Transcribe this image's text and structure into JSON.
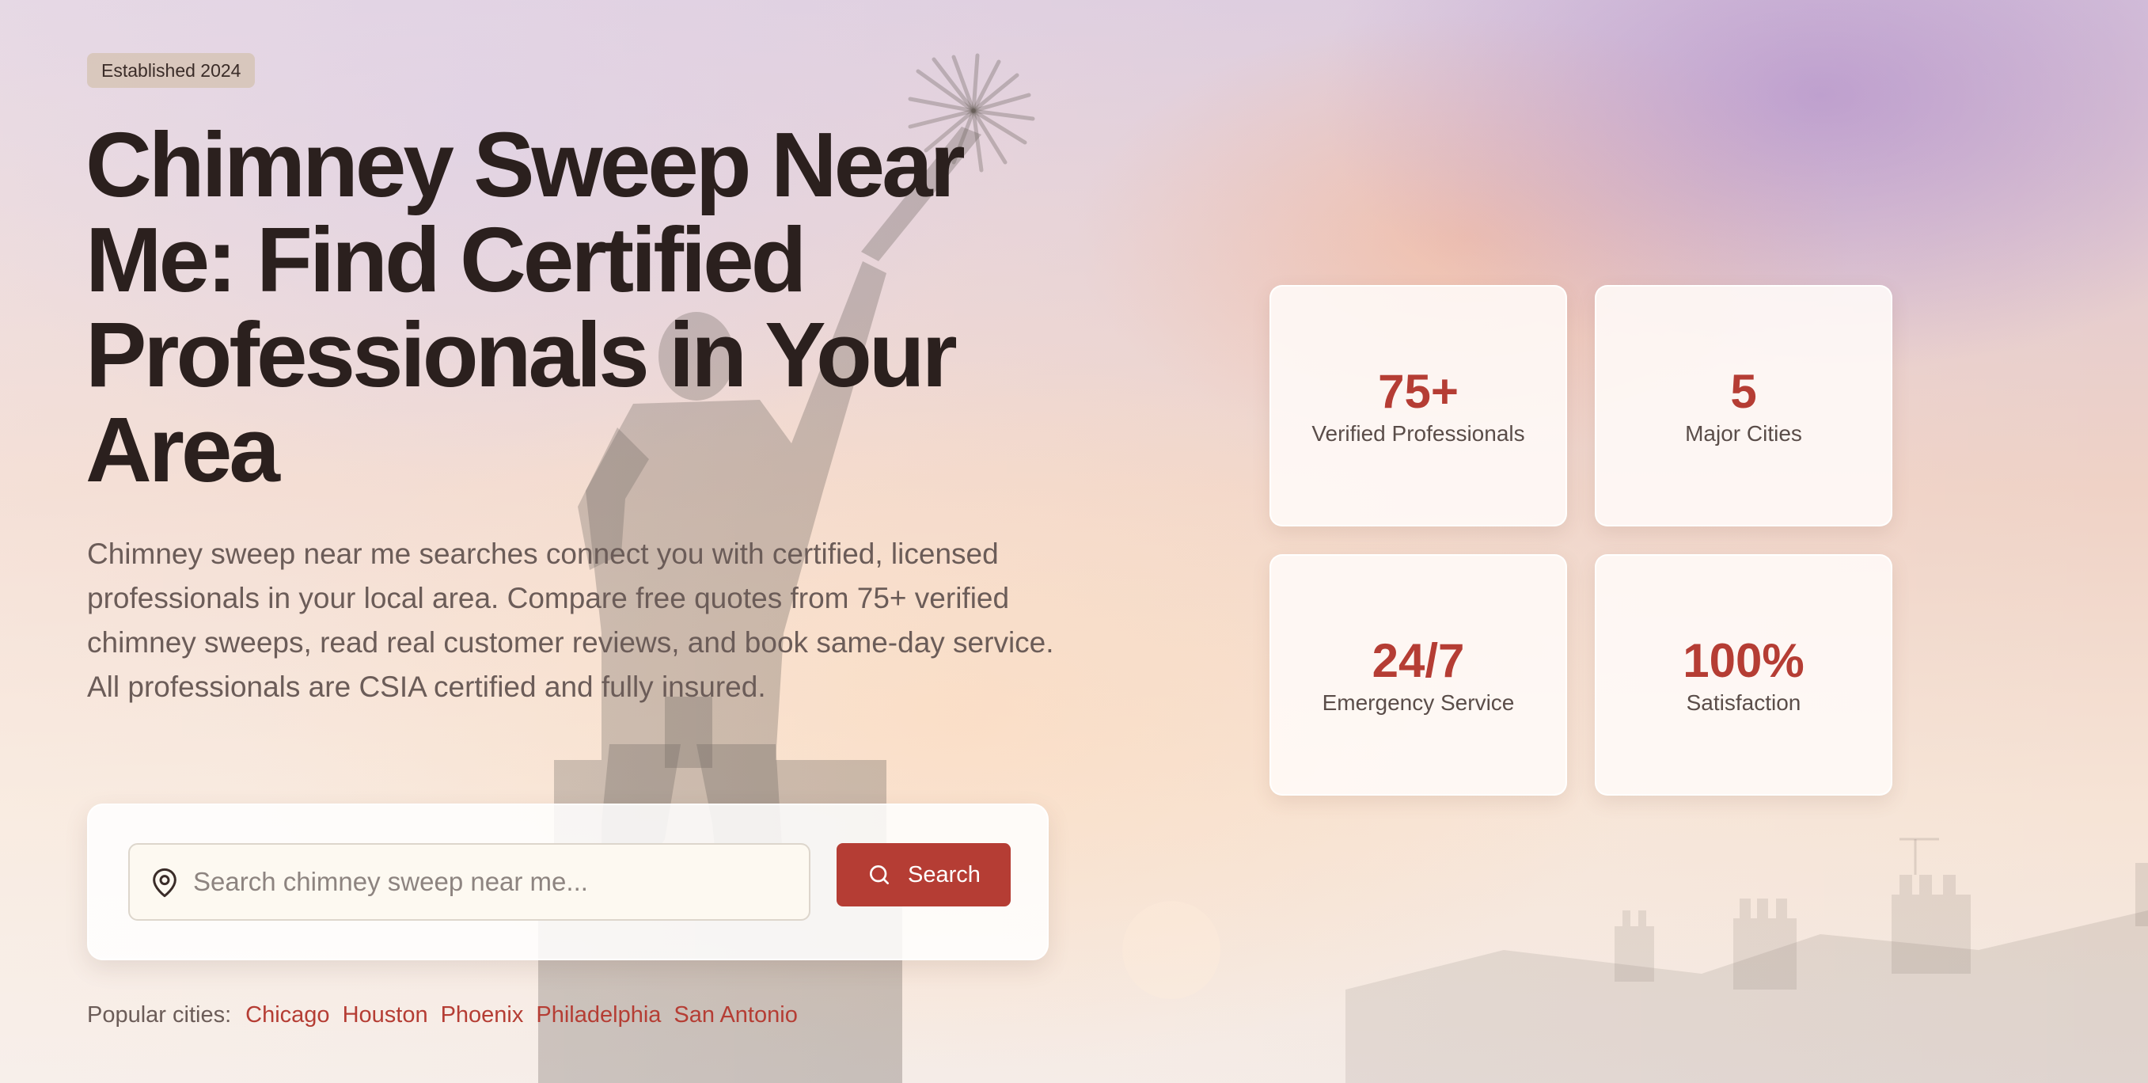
{
  "hero": {
    "badge": "Established 2024",
    "title": "Chimney Sweep Near Me: Find Certified Professionals in Your Area",
    "description": "Chimney sweep near me searches connect you with certified, licensed professionals in your local area. Compare free quotes from 75+ verified chimney sweeps, read real customer reviews, and book same-day service. All professionals are CSIA certified and fully insured."
  },
  "search": {
    "placeholder": "Search chimney sweep near me...",
    "value": "",
    "button_label": "Search",
    "field_icon": "map-pin-icon",
    "button_icon": "search-icon"
  },
  "popular": {
    "label": "Popular cities:",
    "cities": [
      "Chicago",
      "Houston",
      "Phoenix",
      "Philadelphia",
      "San Antonio"
    ]
  },
  "stats": [
    {
      "value": "75+",
      "label": "Verified Professionals"
    },
    {
      "value": "5",
      "label": "Major Cities"
    },
    {
      "value": "24/7",
      "label": "Emergency Service"
    },
    {
      "value": "100%",
      "label": "Satisfaction"
    }
  ],
  "colors": {
    "accent": "#b53d34",
    "heading": "#2b201e",
    "body_text": "#6b5c58"
  }
}
